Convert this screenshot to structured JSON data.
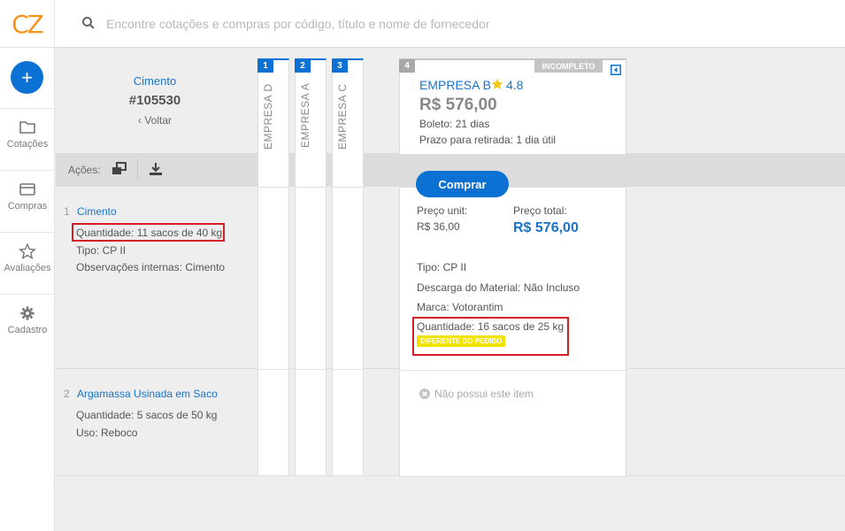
{
  "app": {
    "logo": "CZ"
  },
  "search": {
    "placeholder": "Encontre cotações e compras por código, título e nome de fornecedor"
  },
  "sidebar": {
    "new_label": "+",
    "items": [
      {
        "label": "Cotações",
        "icon": "folder-icon"
      },
      {
        "label": "Compras",
        "icon": "credit-card-icon"
      },
      {
        "label": "Avaliações",
        "icon": "star-icon"
      },
      {
        "label": "Cadastro",
        "icon": "gear-icon"
      }
    ]
  },
  "quote": {
    "title": "Cimento",
    "number": "#105530",
    "back": "‹ Voltar"
  },
  "actions": {
    "label": "Ações:"
  },
  "items": [
    {
      "num": "1",
      "name": "Cimento",
      "fields": [
        "Quantidade:  11 sacos de 40 kg",
        "Tipo:  CP II",
        "Observações internas:  Cimento"
      ]
    },
    {
      "num": "2",
      "name": "Argamassa Usinada em Saco",
      "fields": [
        "Quantidade:  5 sacos de 50 kg",
        "Uso:  Reboco"
      ]
    }
  ],
  "suppliers_collapsed": [
    {
      "num": "1",
      "name": "EMPRESA D"
    },
    {
      "num": "2",
      "name": "EMPRESA A"
    },
    {
      "num": "3",
      "name": "EMPRESA C"
    }
  ],
  "supplier_card": {
    "num": "4",
    "status": "INCOMPLETO",
    "name": "EMPRESA B",
    "rating": "4.8",
    "total": "R$ 576,00",
    "payment": "Boleto: 21 dias",
    "pickup": "Prazo para retirada:  1 dia útil",
    "buy_label": "Comprar",
    "unit_price_label": "Preço unit:",
    "unit_price": "R$ 36,00",
    "total_price_label": "Preço total:",
    "total_price": "R$ 576,00",
    "details": [
      "Tipo:  CP II",
      "Descarga do Material:  Não Incluso",
      "Marca:  Votorantim",
      "Quantidade:  16 sacos de 25 kg"
    ],
    "diff_tag": "DIFERENTE DO PEDIDO",
    "missing_item": "Não possui este item"
  },
  "colors": {
    "accent": "#0b72d3",
    "logo": "#f7941d",
    "highlight": "#d71d25",
    "warning": "#f2e200"
  }
}
